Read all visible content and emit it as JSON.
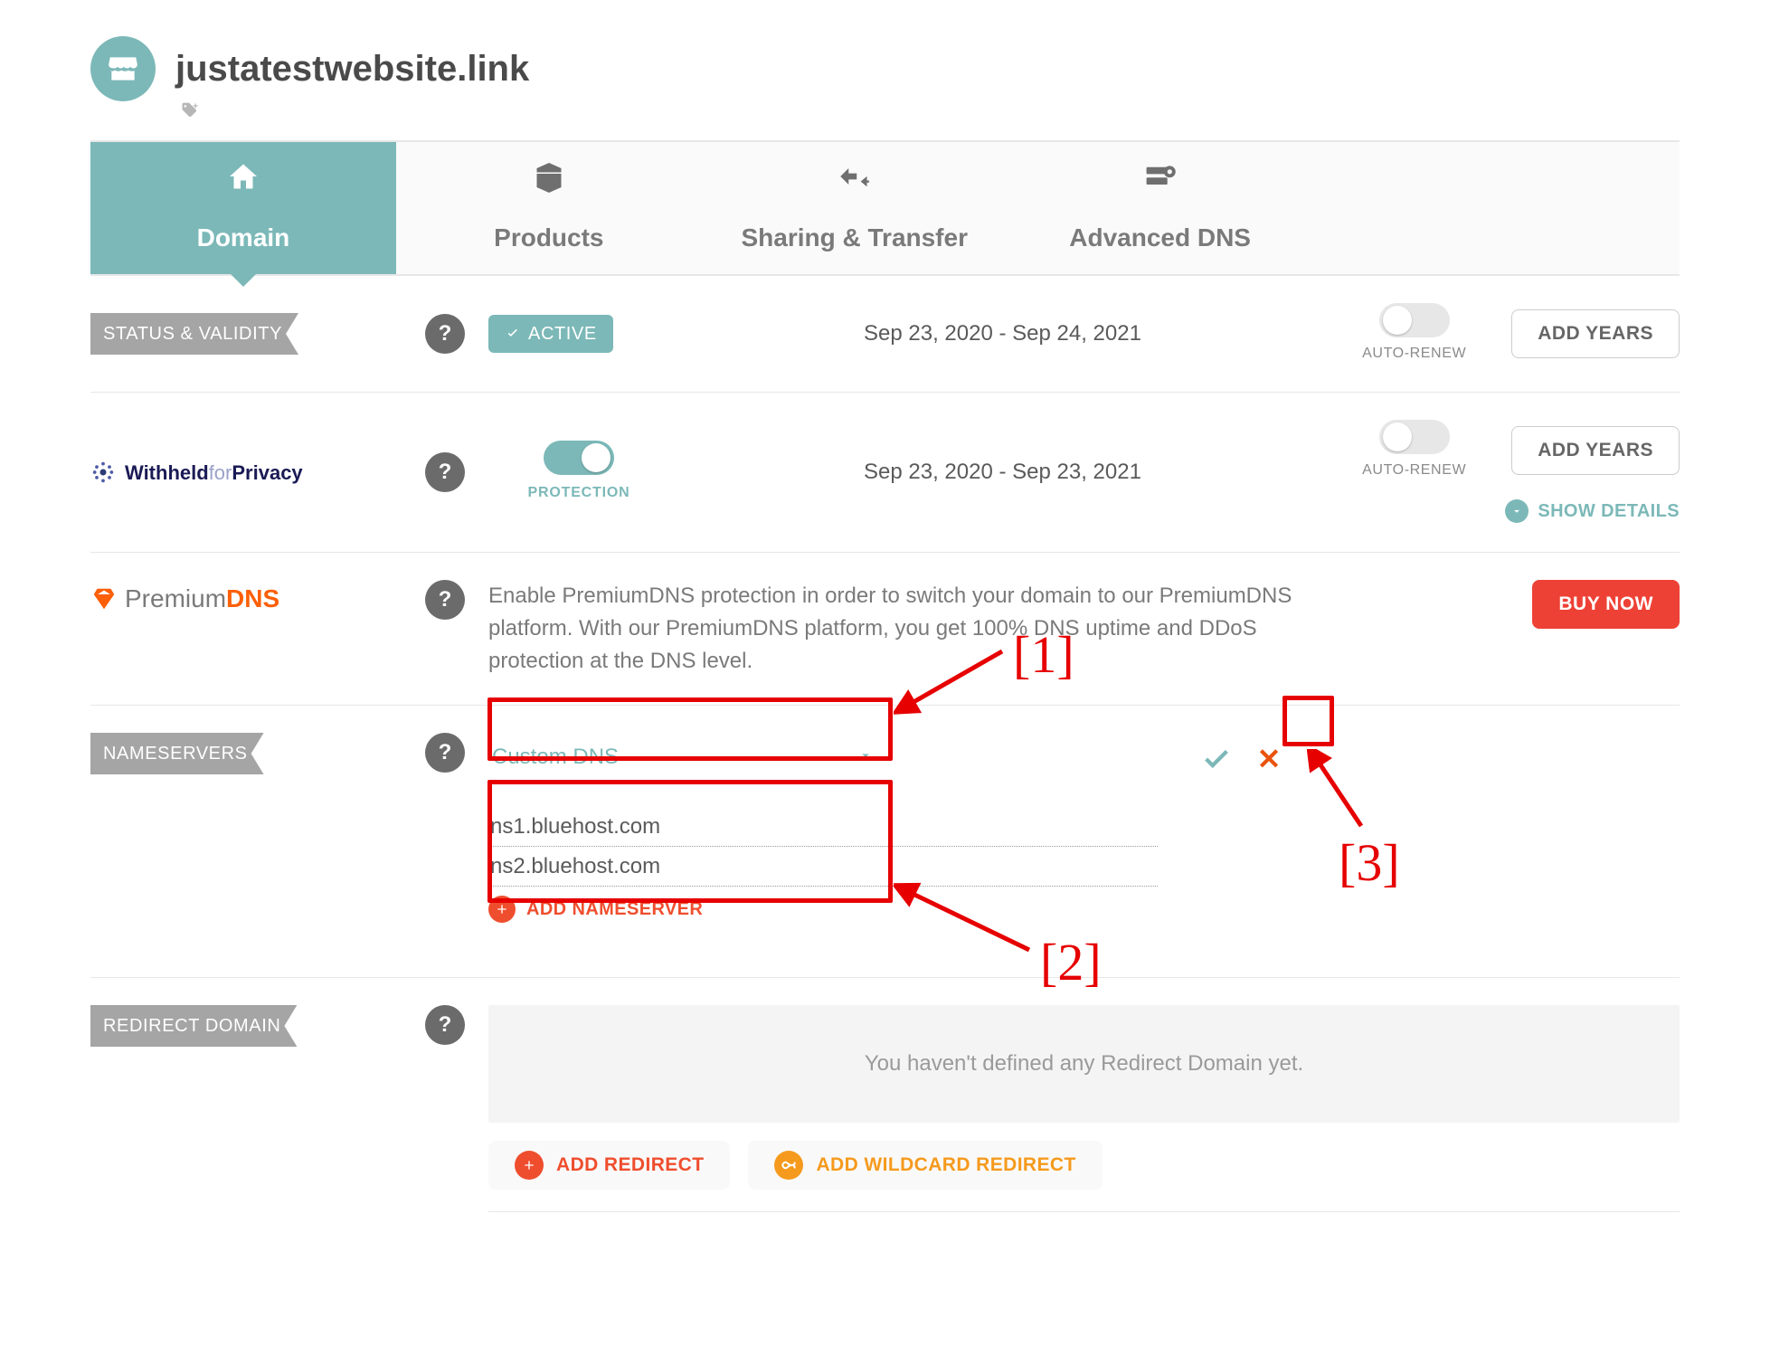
{
  "header": {
    "domain_name": "justatestwebsite.link"
  },
  "tabs": {
    "domain": "Domain",
    "products": "Products",
    "sharing": "Sharing & Transfer",
    "advanced": "Advanced DNS"
  },
  "status": {
    "label": "STATUS & VALIDITY",
    "badge": "ACTIVE",
    "date_range": "Sep 23, 2020 - Sep 24, 2021",
    "auto_renew": "AUTO-RENEW",
    "add_years": "ADD YEARS"
  },
  "privacy": {
    "logo_text_left": "Withheld",
    "logo_text_mid": "for",
    "logo_text_right": "Privacy",
    "protection_label": "PROTECTION",
    "date_range": "Sep 23, 2020 - Sep 23, 2021",
    "auto_renew": "AUTO-RENEW",
    "add_years": "ADD YEARS",
    "show_details": "SHOW DETAILS"
  },
  "premiumdns": {
    "logo_premium": "Premium",
    "logo_dns": "DNS",
    "description": "Enable PremiumDNS protection in order to switch your domain to our PremiumDNS platform. With our PremiumDNS platform, you get 100% DNS uptime and DDoS protection at the DNS level.",
    "buy_now": "BUY NOW"
  },
  "nameservers": {
    "label": "NAMESERVERS",
    "select_value": "Custom DNS",
    "ns1": "ns1.bluehost.com",
    "ns2": "ns2.bluehost.com",
    "add_label": "ADD NAMESERVER"
  },
  "redirect": {
    "label": "REDIRECT DOMAIN",
    "empty_text": "You haven't defined any Redirect Domain yet.",
    "add_redirect": "ADD REDIRECT",
    "add_wildcard": "ADD WILDCARD REDIRECT"
  },
  "annotations": {
    "one": "[1]",
    "two": "[2]",
    "three": "[3]"
  }
}
